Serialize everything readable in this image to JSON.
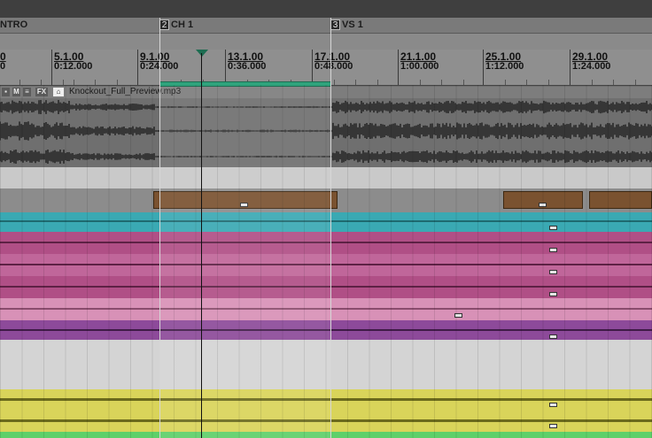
{
  "markers": [
    {
      "num": "",
      "label": "NTRO"
    },
    {
      "num": "2",
      "label": "CH 1"
    },
    {
      "num": "3",
      "label": "VS 1"
    }
  ],
  "ruler": [
    {
      "bar": "0",
      "time": "0"
    },
    {
      "bar": "5.1.00",
      "time": "0:12.000"
    },
    {
      "bar": "9.1.00",
      "time": "0:24.000"
    },
    {
      "bar": "13.1.00",
      "time": "0:36.000"
    },
    {
      "bar": "17.1.00",
      "time": "0:48.000"
    },
    {
      "bar": "21.1.00",
      "time": "1:00.000"
    },
    {
      "bar": "25.1.00",
      "time": "1:12.000"
    },
    {
      "bar": "29.1.00",
      "time": "1:24.000"
    }
  ],
  "track_header": {
    "buttons": [
      "M",
      "≡",
      "FX"
    ],
    "file_name": "Knockout_Full_Preview.mp3"
  },
  "colors": {
    "audio_bg": "#6f6f6f",
    "brown": "#7a5230",
    "teal": "#3aa9b3",
    "magenta": "#b04f86",
    "pink": "#d891b7",
    "purple": "#8d4a9a",
    "yellow": "#d9d45a",
    "green": "#5ed06a",
    "loop": "#2fa37c"
  }
}
